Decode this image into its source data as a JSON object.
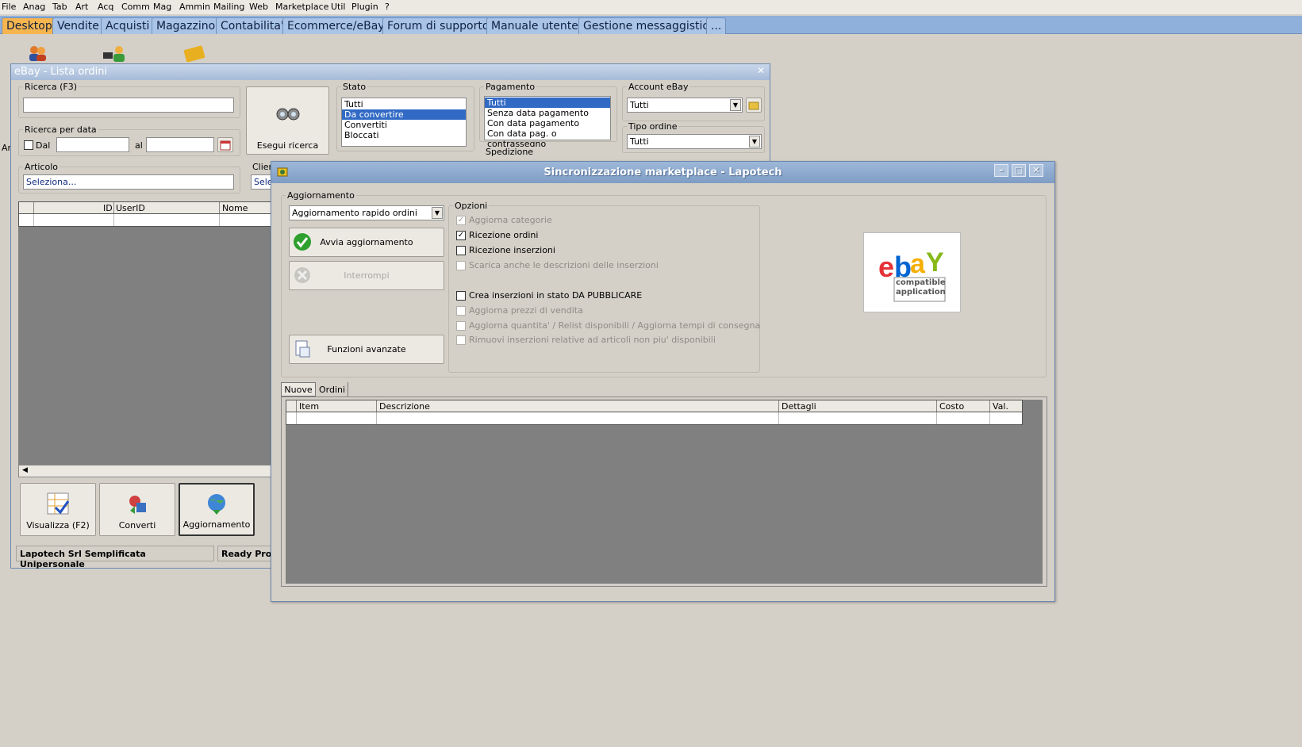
{
  "menu": [
    "File",
    "Anag",
    "Tab",
    "Art",
    "Acq",
    "Comm",
    "Mag",
    "Ammin",
    "Mailing",
    "Web",
    "Marketplace",
    "Util",
    "Plugin",
    "?"
  ],
  "tabs": [
    "Desktop",
    "Vendite",
    "Acquisti",
    "Magazzino",
    "Contabilita'",
    "Ecommerce/eBay",
    "Forum di supporto",
    "Manuale utente",
    "Gestione messaggistica",
    "..."
  ],
  "orders_window": {
    "title": "eBay - Lista ordini",
    "close": "✕",
    "search_label": "Ricerca (F3)",
    "search_value": "",
    "date_group_label": "Ricerca per data",
    "date_from_label": "Dal",
    "date_to_label": "al",
    "date_from_value": "",
    "date_to_value": "",
    "search_button": "Esegui ricerca",
    "stato_label": "Stato",
    "stato_options": [
      "Tutti",
      "Da convertire",
      "Convertiti",
      "Bloccati"
    ],
    "stato_selected": 1,
    "pagamento_label": "Pagamento",
    "pagamento_options": [
      "Tutti",
      "Senza data pagamento",
      "Con data pagamento",
      "Con data pag. o contrassegno"
    ],
    "pagamento_selected": 0,
    "spedizione_label": "Spedizione",
    "account_label": "Account eBay",
    "account_value": "Tutti",
    "tipo_label": "Tipo ordine",
    "tipo_value": "Tutti",
    "articolo_label": "Articolo",
    "articolo_value": "Seleziona...",
    "cliente_label": "Clien",
    "cliente_value": "Sele",
    "left_cut_label": "Ar",
    "grid_cols": [
      "ID",
      "UserID",
      "Nome"
    ],
    "buttons": [
      "Visualizza (F2)",
      "Converti",
      "Aggiornamento"
    ],
    "status_company": "Lapotech Srl Semplificata Unipersonale",
    "status_ready": "Ready Pro V"
  },
  "sync_window": {
    "title": "Sincronizzazione marketplace - Lapotech",
    "win_minimize": "–",
    "win_maximize": "□",
    "win_close": "✕",
    "aggiornamento_label": "Aggiornamento",
    "mode_value": "Aggiornamento rapido ordini",
    "start_button": "Avvia aggiornamento",
    "stop_button": "Interrompi",
    "advanced_button": "Funzioni avanzate",
    "opzioni_label": "Opzioni",
    "options": [
      {
        "label": "Aggiorna categorie",
        "checked": true,
        "enabled": false
      },
      {
        "label": "Ricezione ordini",
        "checked": true,
        "enabled": true
      },
      {
        "label": "Ricezione inserzioni",
        "checked": false,
        "enabled": true
      },
      {
        "label": "Scarica anche le descrizioni delle inserzioni",
        "checked": false,
        "enabled": false
      },
      {
        "label": "Crea inserzioni in stato DA PUBBLICARE",
        "checked": false,
        "enabled": true
      },
      {
        "label": "Aggiorna prezzi di vendita",
        "checked": false,
        "enabled": false
      },
      {
        "label": "Aggiorna quantita' / Relist disponibili / Aggiorna tempi di consegna",
        "checked": false,
        "enabled": false
      },
      {
        "label": "Rimuovi inserzioni relative ad articoli non piu' disponibili",
        "checked": false,
        "enabled": false
      }
    ],
    "logo_caption_1": "compatible",
    "logo_caption_2": "application",
    "tabs": [
      "Nuove",
      "Ordini"
    ],
    "grid_cols": [
      "Item",
      "Descrizione",
      "Dettagli",
      "Costo",
      "Val."
    ]
  },
  "colors": {
    "tab_active": "#f7b550",
    "tab_bar": "#8fb0db",
    "selection": "#316ac5",
    "grid_empty": "#808080"
  }
}
